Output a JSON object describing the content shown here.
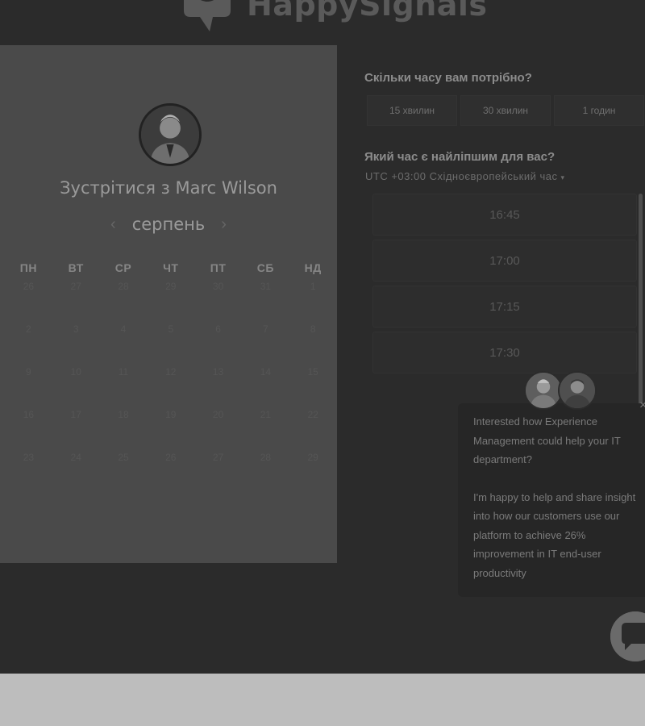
{
  "header": {
    "logo_text": "HappySignals"
  },
  "calendar": {
    "title": "Зустрітися з Marc Wilson",
    "month": "серпень",
    "prev_icon": "chevron-left-icon",
    "next_icon": "chevron-right-icon",
    "weekdays": [
      "ПН",
      "ВТ",
      "СР",
      "ЧТ",
      "ПТ",
      "СБ",
      "НД"
    ],
    "weeks": [
      [
        "26",
        "27",
        "28",
        "29",
        "30",
        "31",
        "1"
      ],
      [
        "2",
        "3",
        "4",
        "5",
        "6",
        "7",
        "8"
      ],
      [
        "9",
        "10",
        "11",
        "12",
        "13",
        "14",
        "15"
      ],
      [
        "16",
        "17",
        "18",
        "19",
        "20",
        "21",
        "22"
      ],
      [
        "23",
        "24",
        "25",
        "26",
        "27",
        "28",
        "29"
      ]
    ]
  },
  "duration": {
    "question": "Скільки часу вам потрібно?",
    "options": [
      "15 хвилин",
      "30 хвилин",
      "1 годин"
    ]
  },
  "time": {
    "question": "Який час є найліпшим для вас?",
    "timezone": "UTC +03:00 Східноєвропейський час",
    "slots": [
      "16:45",
      "17:00",
      "17:15",
      "17:30"
    ]
  },
  "chat": {
    "message_1": "Interested how Experience Management could help your IT department?",
    "message_2": "I'm happy to help and share insight into how our customers use our platform to achieve 26% improvement in IT end-user productivity",
    "close_icon": "close-icon",
    "launcher_icon": "chat-bubble-icon"
  }
}
